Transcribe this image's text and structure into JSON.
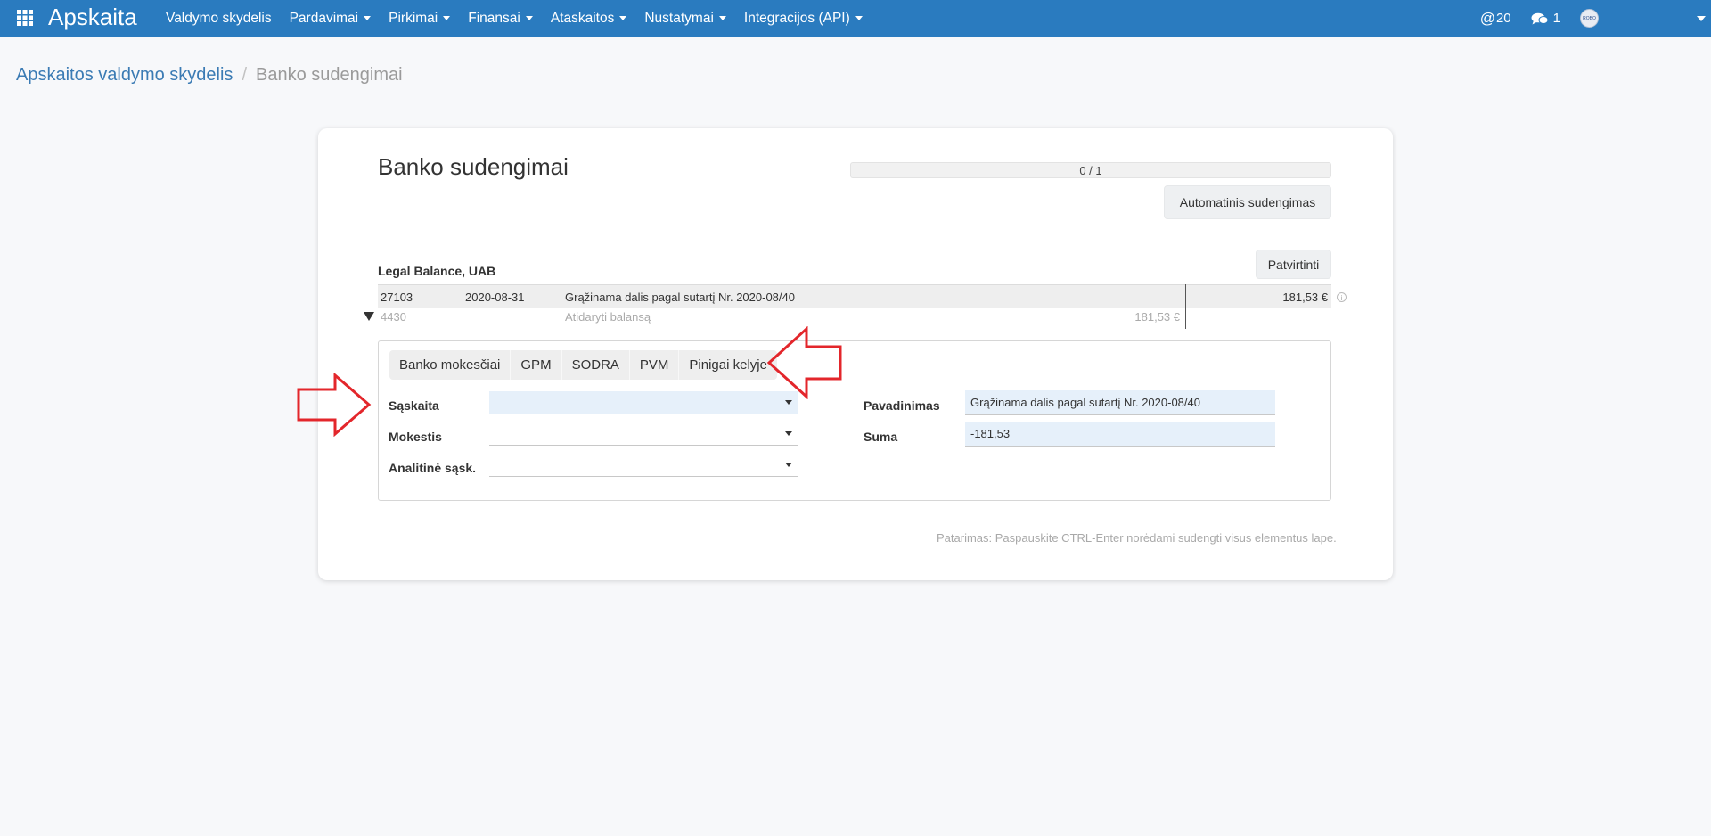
{
  "app": {
    "brand": "Apskaita"
  },
  "nav": {
    "items": [
      {
        "label": "Valdymo skydelis",
        "has_caret": false
      },
      {
        "label": "Pardavimai",
        "has_caret": true
      },
      {
        "label": "Pirkimai",
        "has_caret": true
      },
      {
        "label": "Finansai",
        "has_caret": true
      },
      {
        "label": "Ataskaitos",
        "has_caret": true
      },
      {
        "label": "Nustatymai",
        "has_caret": true
      },
      {
        "label": "Integracijos (API)",
        "has_caret": true
      }
    ],
    "mentions_count": "20",
    "messages_count": "1",
    "avatar_text": "ROBO"
  },
  "breadcrumb": {
    "root": "Apskaitos valdymo skydelis",
    "separator": "/",
    "current": "Banko sudengimai"
  },
  "page": {
    "title": "Banko sudengimai",
    "progress_text": "0 / 1",
    "auto_button": "Automatinis sudengimas",
    "confirm_button": "Patvirtinti",
    "company": "Legal Balance, UAB"
  },
  "transaction": {
    "id": "27103",
    "date": "2020-08-31",
    "description": "Grąžinama dalis pagal sutartį Nr. 2020-08/40",
    "amount": "181,53 €",
    "sub": {
      "account": "4430",
      "description": "Atidaryti balansą",
      "amount": "181,53 €"
    }
  },
  "tabs": [
    "Banko mokesčiai",
    "GPM",
    "SODRA",
    "PVM",
    "Pinigai kelyje"
  ],
  "form": {
    "account_label": "Sąskaita",
    "tax_label": "Mokestis",
    "analytic_label": "Analitinė sąsk.",
    "name_label": "Pavadinimas",
    "name_value": "Grąžinama dalis pagal sutartį Nr. 2020-08/40",
    "sum_label": "Suma",
    "sum_value": "-181,53"
  },
  "hint": "Patarimas: Paspauskite CTRL-Enter norėdami sudengti visus elementus lape.",
  "colors": {
    "navbar": "#2a7bbf",
    "link": "#3b7bb4",
    "arrow": "#e3262b",
    "field_active": "#e6f0fa"
  }
}
